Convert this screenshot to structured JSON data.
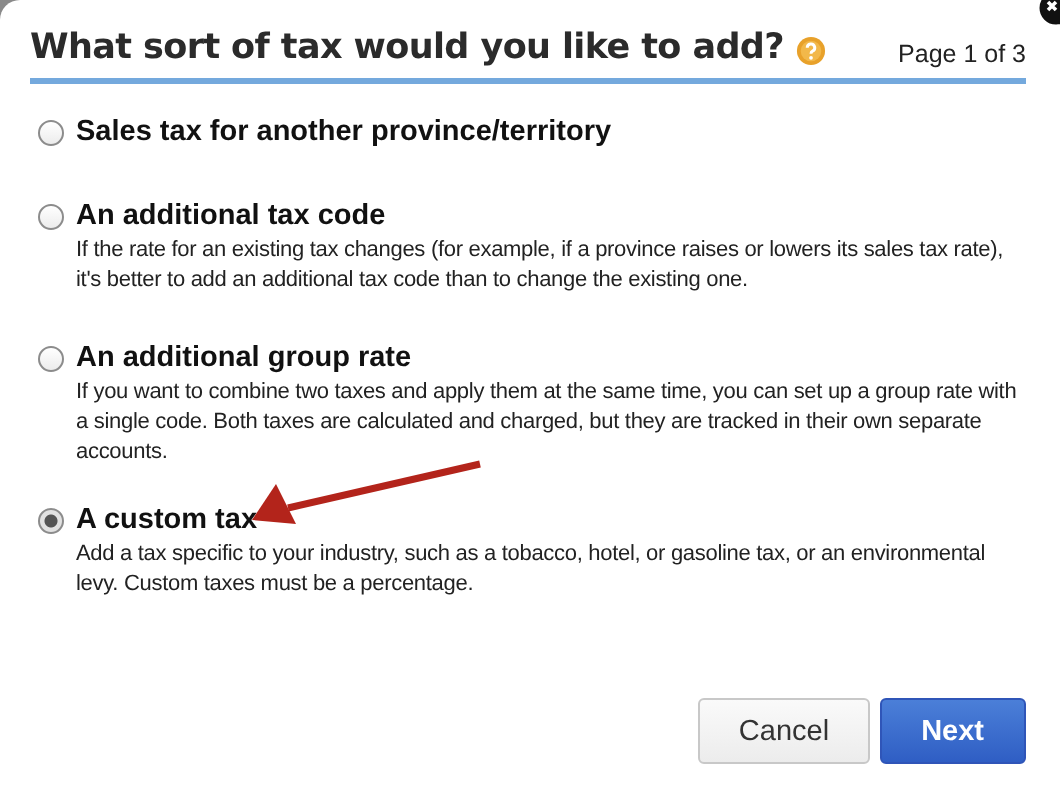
{
  "dialog": {
    "title": "What sort of tax would you like to add?",
    "page_indicator": "Page 1 of 3"
  },
  "options": [
    {
      "label": "Sales tax for another province/territory",
      "selected": false
    },
    {
      "label": "An additional tax code",
      "description": "If the rate for an existing tax changes (for example, if a province raises or lowers its sales tax rate), it's better to add an additional tax code than to change the existing one.",
      "selected": false
    },
    {
      "label": "An additional group rate",
      "description": "If you want to combine two taxes and apply them at the same time, you can set up a group rate with a single code. Both taxes are calculated and charged, but they are tracked in their own separate accounts.",
      "selected": false
    },
    {
      "label": "A custom tax",
      "description": "Add a tax specific to your industry, such as a tobacco, hotel, or gasoline tax, or an environmental levy. Custom taxes must be a percentage.",
      "selected": true
    }
  ],
  "buttons": [
    {
      "label": "Cancel",
      "kind": "secondary"
    },
    {
      "label": "Next",
      "kind": "primary"
    }
  ]
}
